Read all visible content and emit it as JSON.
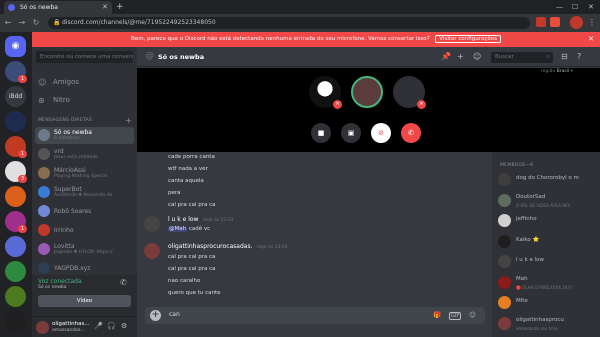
{
  "browser": {
    "tab_title": "Só os newba",
    "url": "discord.com/channels/@me/719522492523348050"
  },
  "notice": {
    "text": "Bem, parece que o Discord não está detectando nenhuma entrada do seu microfone. Vamos consertar isso?",
    "action": "Visitar configurações"
  },
  "guilds": [
    {
      "label": "",
      "color": "#5865f2",
      "badge": ""
    },
    {
      "label": "",
      "color": "#3b4c7a",
      "badge": "1"
    },
    {
      "label": "iBdd",
      "color": "#36393f",
      "badge": ""
    },
    {
      "label": "",
      "color": "#1d2b4f",
      "badge": ""
    },
    {
      "label": "",
      "color": "#c23a22",
      "badge": "1"
    },
    {
      "label": "",
      "color": "#e0e0e0",
      "badge": "3"
    },
    {
      "label": "",
      "color": "#d95f1a",
      "badge": ""
    },
    {
      "label": "",
      "color": "#a12e8c",
      "badge": "1"
    },
    {
      "label": "",
      "color": "#5a6bd8",
      "badge": ""
    },
    {
      "label": "",
      "color": "#2d8a3e",
      "badge": ""
    },
    {
      "label": "",
      "color": "#4b7a1f",
      "badge": ""
    },
    {
      "label": "",
      "color": "#1f1f1f",
      "badge": ""
    }
  ],
  "dm_sidebar": {
    "search_placeholder": "Encontre ou comece uma conversa",
    "nav": [
      {
        "label": "Amigos",
        "icon": "friends-icon"
      },
      {
        "label": "Nitro",
        "icon": "nitro-icon"
      }
    ],
    "header": "MENSAGENS DIRETAS",
    "items": [
      {
        "name": "Só os newba",
        "sub": "8 membros",
        "color": "#6c7a89",
        "active": true
      },
      {
        "name": "vrd",
        "sub": "Jesus está voltando",
        "color": "#555555",
        "active": false
      },
      {
        "name": "MárcioAssi",
        "sub": "Playing Nothing Special",
        "color": "#8a6d4f",
        "active": false
      },
      {
        "name": "SuperBot",
        "sub": "Assistindo ✚ Necessita de",
        "color": "#3a7bd5",
        "active": false
      },
      {
        "name": "Robô Soares",
        "sub": "",
        "color": "#7289da",
        "active": false
      },
      {
        "name": "Irrinho",
        "sub": "",
        "color": "#c0392b",
        "active": false
      },
      {
        "name": "Lovitta",
        "sub": "Jogando ✚ HYLOX: https://",
        "color": "#9b59b6",
        "active": false
      },
      {
        "name": "YAGPDB.xyz",
        "sub": "",
        "color": "#2c3e50",
        "active": false
      }
    ],
    "voice_status": "Voz conectada",
    "voice_channel": "Só os newba",
    "video_label": "Vídeo",
    "user_name": "oligattinhas...",
    "user_tag": "amassandoe..."
  },
  "channel": {
    "title": "Só os newba",
    "search_placeholder": "Buscar",
    "region_label": "região",
    "region_value": "Brasil"
  },
  "messages": {
    "lines_top": [
      "cade porra canta",
      "wtf nada a ver",
      "canta aquela",
      "pera",
      "cal pra cal pra ca"
    ],
    "msg1_author": "l u k e low",
    "msg1_time": "Hoje às 13:33",
    "msg1_mention": "@Mah",
    "msg1_text": "cadê vc",
    "msg2_author": "oligattinhasprocurocasadas.",
    "msg2_time": "Hoje às 13:34",
    "msg2_lines": [
      "cal pra cal pra ca",
      "cal pra cal pra ca",
      "nao caralho",
      "quero que tu cante"
    ],
    "composer_text": "can"
  },
  "members": {
    "header": "MEMBROS—6",
    "list": [
      {
        "name": "dog do Chororobyl o m",
        "sub": "",
        "color": "#3e3e3e"
      },
      {
        "name": "DoutorSad",
        "sub": "O XRL DE VIDEO AULA VEY..",
        "color": "#5e6b5e"
      },
      {
        "name": "jeffinho",
        "sub": "",
        "color": "#d0d0d0"
      },
      {
        "name": "Kaiko ⭐",
        "sub": "",
        "color": "#1e1e1e"
      },
      {
        "name": "l u k e low",
        "sub": "",
        "color": "#444444"
      },
      {
        "name": "Mah",
        "sub": "🔴 OLHA O PIXELXXXX 1K!!!",
        "color": "#8b1a1a"
      },
      {
        "name": "Mlto",
        "sub": "",
        "color": "#e67e22"
      },
      {
        "name": "oligattinhasprocu",
        "sub": "amassando seu time",
        "color": "#7a3b3b"
      }
    ]
  }
}
